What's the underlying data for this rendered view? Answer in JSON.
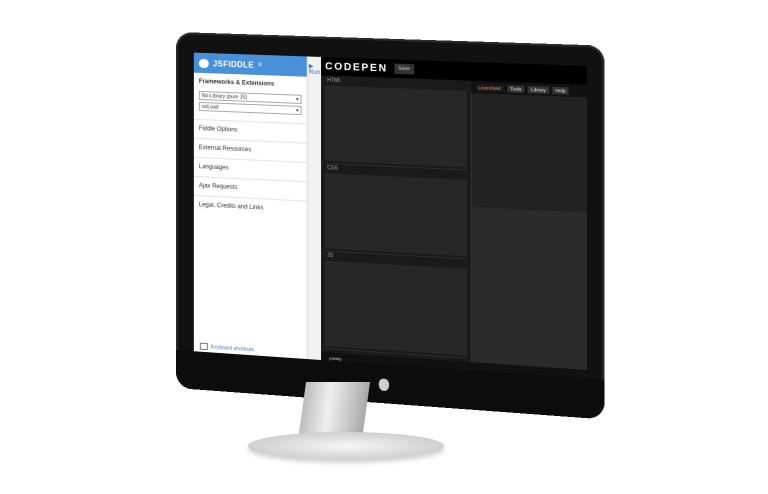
{
  "jsfiddle": {
    "title": "JSFIDDLE",
    "run_label": "Run",
    "sections": {
      "frameworks_title": "Frameworks & Extensions",
      "library_select": "No-Library (pure JS)",
      "load_select": "onLoad"
    },
    "menu_items": [
      "Fiddle Options",
      "External Resources",
      "Languages",
      "Ajax Requests",
      "Legal, Credits and Links"
    ],
    "footer_link": "Keyboard shortcuts"
  },
  "codepen": {
    "logo": "CODEPEN",
    "save_label": "Save",
    "preview_tabs": [
      "Livereload",
      "Tools",
      "Library",
      "Help"
    ],
    "editor_labels": [
      "HTML",
      "CSS",
      "JS"
    ],
    "footer_status": "prettify"
  },
  "colors": {
    "jsfiddle_header": "#4a90d9",
    "codepen_bg": "#1a1a1a",
    "livereload_accent": "#ff9a2e"
  }
}
